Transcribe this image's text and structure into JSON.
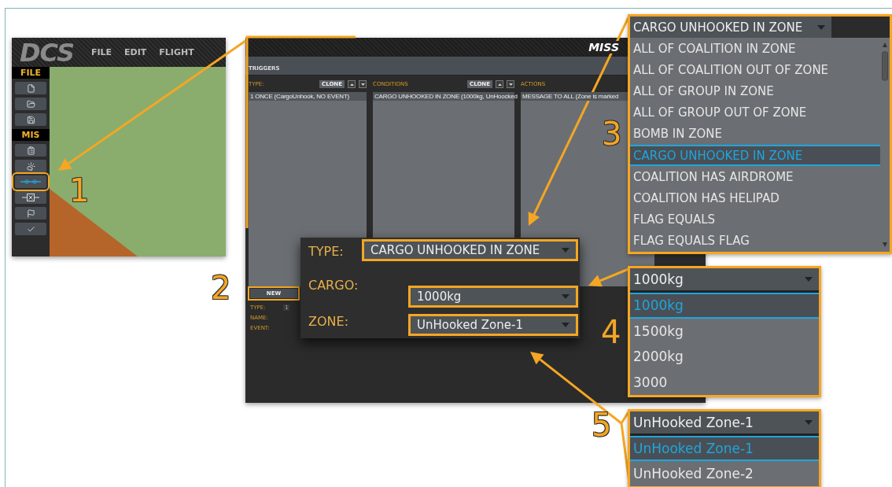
{
  "editor": {
    "logo": "DCS",
    "menu": [
      "FILE",
      "EDIT",
      "FLIGHT"
    ],
    "sections": [
      {
        "title": "FILE",
        "tools": [
          {
            "kind": "new",
            "selected": false
          },
          {
            "kind": "open",
            "selected": false
          },
          {
            "kind": "save",
            "selected": false
          }
        ]
      },
      {
        "title": "MIS",
        "tools": [
          {
            "kind": "briefing",
            "selected": false
          },
          {
            "kind": "weather",
            "selected": false
          },
          {
            "kind": "triggers",
            "selected": true
          },
          {
            "kind": "template",
            "selected": false
          },
          {
            "kind": "flags",
            "selected": false
          },
          {
            "kind": "check",
            "selected": false
          }
        ]
      }
    ]
  },
  "triggers": {
    "title": "MISS",
    "section": "TRIGGERS",
    "columns": [
      {
        "label": "TYPE:",
        "clone": "CLONE",
        "items": [
          "1 ONCE (CargoUnhook, NO EVENT)"
        ]
      },
      {
        "label": "CONDITIONS",
        "clone": "CLONE",
        "items": [
          "CARGO UNHOOKED IN ZONE (1000kg, UnHoocked"
        ]
      },
      {
        "label": "ACTIONS",
        "items": [
          "MESSAGE TO ALL (Zone is marked"
        ]
      }
    ],
    "new_button": "NEW",
    "fields": [
      {
        "label": "TYPE:",
        "value": "1"
      },
      {
        "label": "NAME:"
      },
      {
        "label": "EVENT:"
      }
    ]
  },
  "condition_popup": {
    "fields": [
      {
        "label": "TYPE:",
        "value": "CARGO UNHOOKED IN ZONE"
      },
      {
        "label": "CARGO:",
        "value": "1000kg"
      },
      {
        "label": "ZONE:",
        "value": "UnHooked Zone-1"
      }
    ]
  },
  "dropdowns": [
    {
      "value": "CARGO UNHOOKED IN ZONE",
      "options": [
        {
          "label": "ALL OF COALITION IN ZONE",
          "selected": false
        },
        {
          "label": "ALL OF COALITION OUT OF ZONE",
          "selected": false
        },
        {
          "label": "ALL OF GROUP IN ZONE",
          "selected": false
        },
        {
          "label": "ALL OF GROUP OUT OF ZONE",
          "selected": false
        },
        {
          "label": "BOMB IN ZONE",
          "selected": false
        },
        {
          "label": "CARGO UNHOOKED IN ZONE",
          "selected": true
        },
        {
          "label": "COALITION HAS AIRDROME",
          "selected": false
        },
        {
          "label": "COALITION HAS HELIPAD",
          "selected": false
        },
        {
          "label": "FLAG EQUALS",
          "selected": false
        },
        {
          "label": "FLAG EQUALS FLAG",
          "selected": false
        }
      ]
    },
    {
      "value": "1000kg",
      "options": [
        {
          "label": "1000kg",
          "selected": true
        },
        {
          "label": "1500kg",
          "selected": false
        },
        {
          "label": "2000kg",
          "selected": false
        },
        {
          "label": "3000",
          "selected": false
        }
      ]
    },
    {
      "value": "UnHooked Zone-1",
      "options": [
        {
          "label": "UnHooked Zone-1",
          "selected": true
        },
        {
          "label": "UnHooked Zone-2",
          "selected": false
        }
      ]
    }
  ],
  "callouts": [
    "1",
    "2",
    "3",
    "4",
    "5"
  ]
}
